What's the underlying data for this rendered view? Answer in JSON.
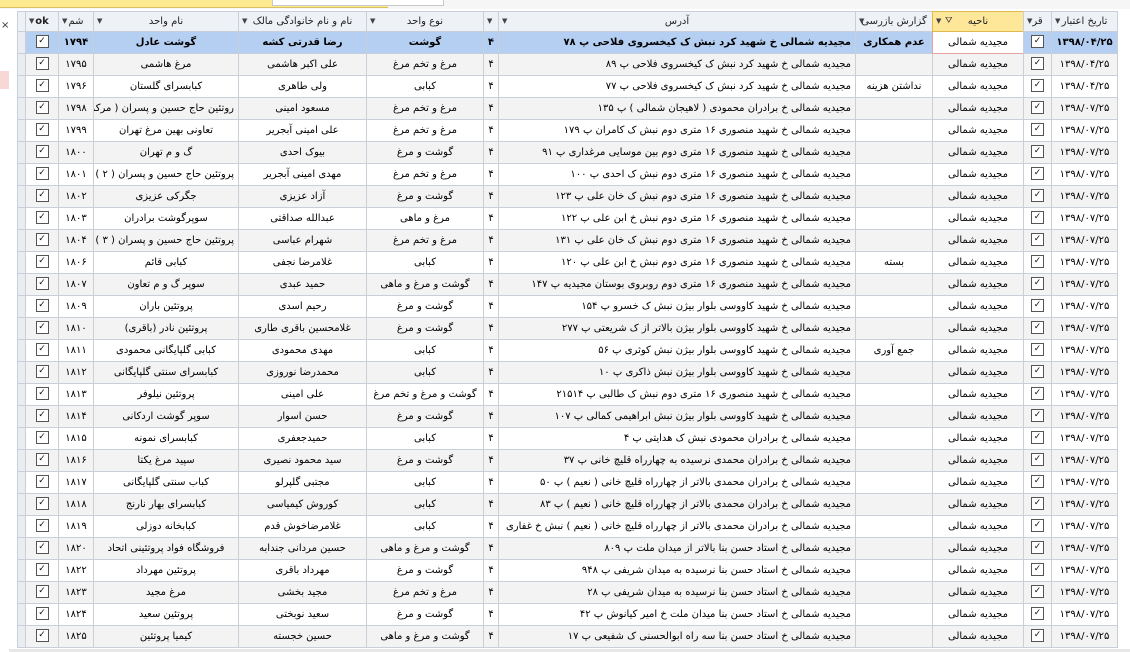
{
  "headers": {
    "date": "تاریخ اعتبار",
    "q": "قر",
    "area": "ناحیه",
    "report": "گزارش بازرسی",
    "address": "آدرس",
    "h4": "",
    "type": "نوع واحد",
    "owner": "نام و نام خانوادگی مالک",
    "unit": "نام واحد",
    "number": "شم",
    "ok": "ok"
  },
  "rows": [
    {
      "date": "۱۳۹۸/۰۴/۲۵",
      "q": "✓",
      "area": "مجیدیه شمالی",
      "report": "عدم همکاری",
      "address": "مجیدیه شمالی خ شهید کرد نبش ک کیخسروی فلاحی پ ۷۸",
      "c": "۴",
      "type": "گوشت",
      "owner": "رضا قدرتی کشه",
      "unit": "گوشت عادل",
      "num": "۱۷۹۴",
      "ok": "✓"
    },
    {
      "date": "۱۳۹۸/۰۴/۲۵",
      "q": "✓",
      "area": "مجیدیه شمالی",
      "report": "",
      "address": "مجیدیه شمالی خ شهید کرد نبش ک کیخسروی فلاحی پ ۸۹",
      "c": "۴",
      "type": "مرغ و تخم مرغ",
      "owner": "علی اکبر هاشمی",
      "unit": "مرغ هاشمی",
      "num": "۱۷۹۵",
      "ok": "✓"
    },
    {
      "date": "۱۳۹۸/۰۴/۲۵",
      "q": "✓",
      "area": "مجیدیه شمالی",
      "report": "نداشتن هزینه",
      "address": "مجیدیه شمالی خ شهید کرد نبش ک کیخسروی فلاحی پ ۷۷",
      "c": "۴",
      "type": "کبابی",
      "owner": "ولی طاهری",
      "unit": "کبابسرای گلستان",
      "num": "۱۷۹۶",
      "ok": "✓"
    },
    {
      "date": "۱۳۹۸/۰۷/۲۵",
      "q": "✓",
      "area": "مجیدیه شمالی",
      "report": "",
      "address": "مجیدیه شمالی خ برادران محمودی ( لاهیجان شمالی ) پ ۱۳۵",
      "c": "۴",
      "type": "مرغ و تخم مرغ",
      "owner": "مسعود امینی",
      "unit": "روتئین حاج حسین و پسران ( مرکزی",
      "num": "۱۷۹۸",
      "ok": "✓"
    },
    {
      "date": "۱۳۹۸/۰۷/۲۵",
      "q": "✓",
      "area": "مجیدیه شمالی",
      "report": "",
      "address": "مجیدیه شمالی خ شهید منصوری ۱۶ متری دوم نبش ک کامران پ ۱۷۹",
      "c": "۴",
      "type": "مرغ و تخم مرغ",
      "owner": "علی امینی آبجریر",
      "unit": "تعاونی بهین مرغ تهران",
      "num": "۱۷۹۹",
      "ok": "✓"
    },
    {
      "date": "۱۳۹۸/۰۷/۲۵",
      "q": "✓",
      "area": "مجیدیه شمالی",
      "report": "",
      "address": "مجیدیه شمالی خ شهید منصوری ۱۶ متری دوم بین موسایی مرغداری پ ۹۱",
      "c": "۴",
      "type": "گوشت و مرغ",
      "owner": "بیوک احدی",
      "unit": "گ و م تهران",
      "num": "۱۸۰۰",
      "ok": "✓"
    },
    {
      "date": "۱۳۹۸/۰۷/۲۵",
      "q": "✓",
      "area": "مجیدیه شمالی",
      "report": "",
      "address": "مجیدیه شمالی خ شهید منصوری ۱۶ متری دوم نبش ک احدی پ ۱۰۰",
      "c": "۴",
      "type": "مرغ و تخم مرغ",
      "owner": "مهدی امینی آبجریر",
      "unit": "پروتئین حاج حسین و پسران ( ۲ )",
      "num": "۱۸۰۱",
      "ok": "✓"
    },
    {
      "date": "۱۳۹۸/۰۷/۲۵",
      "q": "✓",
      "area": "مجیدیه شمالی",
      "report": "",
      "address": "مجیدیه شمالی خ شهید منصوری ۱۶ متری دوم نبش ک خان علی پ ۱۲۳",
      "c": "۴",
      "type": "گوشت و مرغ",
      "owner": "آزاد عزیزی",
      "unit": "جگرکی عزیزی",
      "num": "۱۸۰۲",
      "ok": "✓"
    },
    {
      "date": "۱۳۹۸/۰۷/۲۵",
      "q": "✓",
      "area": "مجیدیه شمالی",
      "report": "",
      "address": "مجیدیه شمالی خ شهید منصوری ۱۶ متری دوم نبش خ ابن علی پ ۱۲۲",
      "c": "۴",
      "type": "مرغ و ماهی",
      "owner": "عبدالله صداقتی",
      "unit": "سوپرگوشت برادران",
      "num": "۱۸۰۳",
      "ok": "✓"
    },
    {
      "date": "۱۳۹۸/۰۷/۲۵",
      "q": "✓",
      "area": "مجیدیه شمالی",
      "report": "",
      "address": "مجیدیه شمالی خ شهید منصوری ۱۶ متری دوم نبش ک خان علی پ ۱۳۱",
      "c": "۴",
      "type": "مرغ و تخم مرغ",
      "owner": "شهرام عباسی",
      "unit": "پروتئین حاج حسین و پسران ( ۳ )",
      "num": "۱۸۰۴",
      "ok": "✓"
    },
    {
      "date": "۱۳۹۸/۰۷/۲۵",
      "q": "✓",
      "area": "مجیدیه شمالی",
      "report": "بسته",
      "address": "مجیدیه شمالی خ شهید منصوری ۱۶ متری دوم نبش خ ابن علی پ ۱۲۰",
      "c": "۴",
      "type": "کبابی",
      "owner": "غلامرضا نجفی",
      "unit": "کبابی قائم",
      "num": "۱۸۰۶",
      "ok": "✓"
    },
    {
      "date": "۱۳۹۸/۰۷/۲۵",
      "q": "✓",
      "area": "مجیدیه شمالی",
      "report": "",
      "address": "مجیدیه شمالی خ شهید منصوری ۱۶ متری دوم روبروی بوستان مجیدیه پ ۱۴۷",
      "c": "۴",
      "type": "گوشت و مرغ و ماهی",
      "owner": "حمید عبدی",
      "unit": "سوپر گ و م تعاون",
      "num": "۱۸۰۷",
      "ok": "✓"
    },
    {
      "date": "۱۳۹۸/۰۷/۲۵",
      "q": "✓",
      "area": "مجیدیه شمالی",
      "report": "",
      "address": "مجیدیه شمالی خ شهید کاووسی بلوار بیژن نبش ک خسرو پ ۱۵۴",
      "c": "۴",
      "type": "گوشت و مرغ",
      "owner": "رحیم اسدی",
      "unit": "پروتئین باران",
      "num": "۱۸۰۹",
      "ok": "✓"
    },
    {
      "date": "۱۳۹۸/۰۷/۲۵",
      "q": "✓",
      "area": "مجیدیه شمالی",
      "report": "",
      "address": "مجیدیه شمالی خ شهید کاووسی بلوار بیژن بالاتر از ک شریعتی پ ۲۷۷",
      "c": "۴",
      "type": "گوشت و مرغ",
      "owner": "غلامحسین باقری طاری",
      "unit": "پروتئین نادر (باقری)",
      "num": "۱۸۱۰",
      "ok": "✓"
    },
    {
      "date": "۱۳۹۸/۰۷/۲۵",
      "q": "✓",
      "area": "مجیدیه شمالی",
      "report": "جمع آوری",
      "address": "مجیدیه شمالی خ شهید کاووسی بلوار بیژن نبش کوثری پ ۵۶",
      "c": "۴",
      "type": "کبابی",
      "owner": "مهدی محمودی",
      "unit": "کبابی گلپایگانی محمودی",
      "num": "۱۸۱۱",
      "ok": "✓"
    },
    {
      "date": "۱۳۹۸/۰۷/۲۵",
      "q": "✓",
      "area": "مجیدیه شمالی",
      "report": "",
      "address": "مجیدیه شمالی خ شهید کاووسی بلوار بیژن نبش ذاکری پ ۱۰",
      "c": "۴",
      "type": "کبابی",
      "owner": "محمدرضا نوروزی",
      "unit": "کبابسرای سنتی گلپایگانی",
      "num": "۱۸۱۲",
      "ok": "✓"
    },
    {
      "date": "۱۳۹۸/۰۷/۲۵",
      "q": "✓",
      "area": "مجیدیه شمالی",
      "report": "",
      "address": "مجیدیه شمالی خ شهید منصوری ۱۶ متری دوم نبش ک طالبی پ ۲۱۵۱۴",
      "c": "۴",
      "type": "گوشت و مرغ و تخم مرغ",
      "owner": "علی امینی",
      "unit": "پروتئین نیلوفر",
      "num": "۱۸۱۳",
      "ok": "✓"
    },
    {
      "date": "۱۳۹۸/۰۷/۲۵",
      "q": "✓",
      "area": "مجیدیه شمالی",
      "report": "",
      "address": "مجیدیه شمالی خ شهید کاووسی بلوار بیژن نبش ابراهیمی کمالی پ ۱۰۷",
      "c": "۴",
      "type": "گوشت و مرغ",
      "owner": "حسن اسوار",
      "unit": "سوپر گوشت اردکانی",
      "num": "۱۸۱۴",
      "ok": "✓"
    },
    {
      "date": "۱۳۹۸/۰۷/۲۵",
      "q": "✓",
      "area": "مجیدیه شمالی",
      "report": "",
      "address": "مجیدیه شمالی خ برادران محمودی نبش ک هدایتی پ ۴",
      "c": "۴",
      "type": "کبابی",
      "owner": "حمیدجعفری",
      "unit": "کبابسرای نمونه",
      "num": "۱۸۱۵",
      "ok": "✓"
    },
    {
      "date": "۱۳۹۸/۰۷/۲۵",
      "q": "✓",
      "area": "مجیدیه شمالی",
      "report": "",
      "address": "مجیدیه شمالی خ برادران محمدی نرسیده به چهارراه قلیچ خانی پ ۳۷",
      "c": "۴",
      "type": "گوشت و مرغ",
      "owner": "سید محمود نصیری",
      "unit": "سپید مرغ یکتا",
      "num": "۱۸۱۶",
      "ok": "✓"
    },
    {
      "date": "۱۳۹۸/۰۷/۲۵",
      "q": "✓",
      "area": "مجیدیه شمالی",
      "report": "",
      "address": "مجیدیه شمالی خ برادران محمدی بالاتر از چهارراه قلیچ خانی ( نعیم ) پ ۵۰",
      "c": "۴",
      "type": "کبابی",
      "owner": "مجتبی گلپرلو",
      "unit": "کباب سنتی گلپایگانی",
      "num": "۱۸۱۷",
      "ok": "✓"
    },
    {
      "date": "۱۳۹۸/۰۷/۲۵",
      "q": "✓",
      "area": "مجیدیه شمالی",
      "report": "",
      "address": "مجیدیه شمالی خ برادران محمدی بالاتر از چهارراه قلیچ خانی ( نعیم ) پ ۸۳",
      "c": "۴",
      "type": "کبابی",
      "owner": "کوروش کیمیاسی",
      "unit": "کبابسرای بهار نارنج",
      "num": "۱۸۱۸",
      "ok": "✓"
    },
    {
      "date": "۱۳۹۸/۰۷/۲۵",
      "q": "✓",
      "area": "مجیدیه شمالی",
      "report": "",
      "address": "مجیدیه شمالی خ برادران محمدی بالاتر از چهارراه قلیچ خانی ( نعیم ) نبش خ غفاری",
      "c": "۴",
      "type": "کبابی",
      "owner": "غلامرضاخوش قدم",
      "unit": "کبابخانه دوزلی",
      "num": "۱۸۱۹",
      "ok": "✓"
    },
    {
      "date": "۱۳۹۸/۰۷/۲۵",
      "q": "✓",
      "area": "مجیدیه شمالی",
      "report": "",
      "address": "مجیدیه شمالی خ استاد حسن بنا بالاتر از میدان ملت پ ۸۰۹",
      "c": "۴",
      "type": "گوشت و مرغ و ماهی",
      "owner": "حسین مردانی جندابه",
      "unit": "فروشگاه فواد پروتئینی اتحاد",
      "num": "۱۸۲۰",
      "ok": "✓"
    },
    {
      "date": "۱۳۹۸/۰۷/۲۵",
      "q": "✓",
      "area": "مجیدیه شمالی",
      "report": "",
      "address": "مجیدیه شمالی خ استاد حسن بنا نرسیده به میدان شریفی پ ۹۴۸",
      "c": "۴",
      "type": "گوشت و مرغ",
      "owner": "مهرداد باقری",
      "unit": "پروتئین مهرداد",
      "num": "۱۸۲۲",
      "ok": "✓"
    },
    {
      "date": "۱۳۹۸/۰۷/۲۵",
      "q": "✓",
      "area": "مجیدیه شمالی",
      "report": "",
      "address": "مجیدیه شمالی خ استاد حسن بنا نرسیده به میدان شریفی پ ۲۸",
      "c": "۴",
      "type": "مرغ و تخم مرغ",
      "owner": "مجید بخشی",
      "unit": "مرغ مجید",
      "num": "۱۸۲۳",
      "ok": "✓"
    },
    {
      "date": "۱۳۹۸/۰۷/۲۵",
      "q": "✓",
      "area": "مجیدیه شمالی",
      "report": "",
      "address": "مجیدیه شمالی خ استاد حسن بنا میدان ملت خ امیر کیانوش پ ۴۲",
      "c": "۴",
      "type": "گوشت و مرغ",
      "owner": "سعید نوبختی",
      "unit": "پروتئین سعید",
      "num": "۱۸۲۴",
      "ok": "✓"
    },
    {
      "date": "۱۳۹۸/۰۷/۲۵",
      "q": "✓",
      "area": "مجیدیه شمالی",
      "report": "",
      "address": "مجیدیه شمالی خ استاد حسن بنا سه راه ابوالحسنی ک شفیعی پ ۱۷",
      "c": "۴",
      "type": "گوشت و مرغ و ماهی",
      "owner": "حسین خجسته",
      "unit": "کیمیا پروتئین",
      "num": "۱۸۲۵",
      "ok": "✓"
    }
  ]
}
